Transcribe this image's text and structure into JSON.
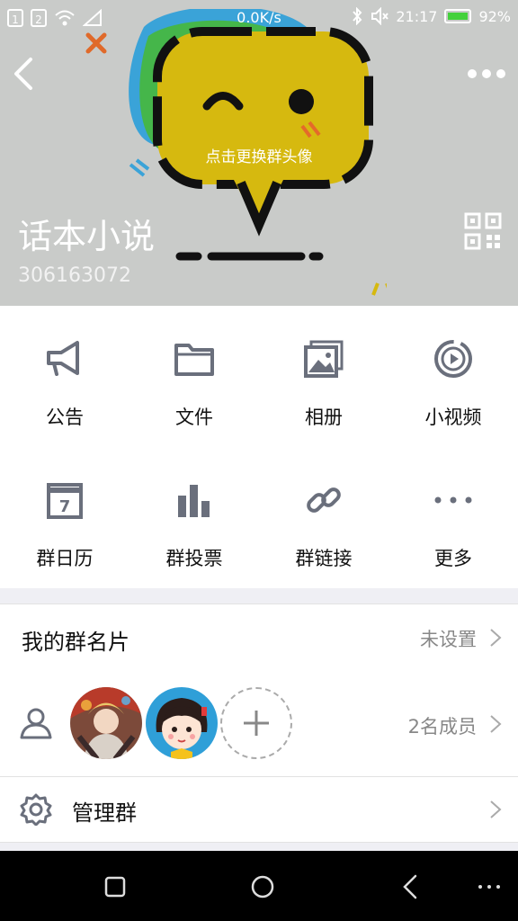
{
  "status_bar": {
    "sim1": "1",
    "sim2": "2",
    "network_speed": "0.0K/s",
    "time": "21:17",
    "battery": "92%"
  },
  "header": {
    "change_avatar_hint": "点击更换群头像",
    "group_name": "话本小说",
    "group_id": "306163072"
  },
  "functions": [
    {
      "label": "公告",
      "icon": "megaphone-icon"
    },
    {
      "label": "文件",
      "icon": "folder-icon"
    },
    {
      "label": "相册",
      "icon": "album-icon"
    },
    {
      "label": "小视频",
      "icon": "video-icon"
    },
    {
      "label": "群日历",
      "icon": "calendar-icon"
    },
    {
      "label": "群投票",
      "icon": "vote-chart-icon"
    },
    {
      "label": "群链接",
      "icon": "link-icon"
    },
    {
      "label": "更多",
      "icon": "more-dots-icon"
    }
  ],
  "calendar_day": "7",
  "my_card": {
    "title": "我的群名片",
    "value": "未设置"
  },
  "members": {
    "count_label": "2名成员"
  },
  "manage": {
    "title": "管理群"
  },
  "colors": {
    "hero_bg": "#c9cbc9",
    "bubble_yellow": "#d6b90f",
    "icon_gray": "#6a6f7c"
  }
}
